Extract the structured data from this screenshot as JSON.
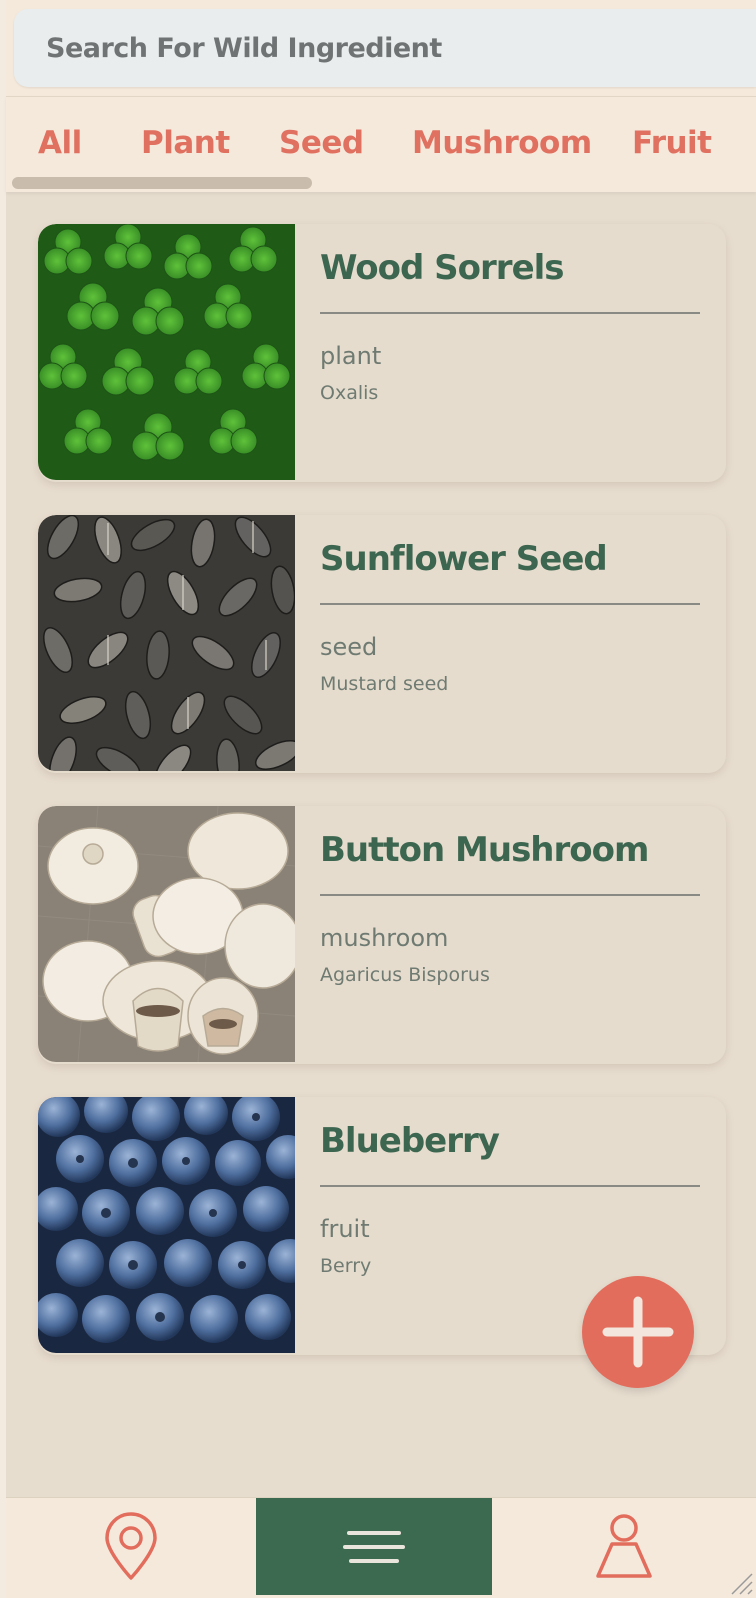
{
  "search": {
    "placeholder": "Search For Wild Ingredient"
  },
  "tabs": [
    {
      "label": "All"
    },
    {
      "label": "Plant"
    },
    {
      "label": "Seed"
    },
    {
      "label": "Mushroom"
    },
    {
      "label": "Fruit"
    }
  ],
  "ingredients": [
    {
      "name": "Wood Sorrels",
      "type": "plant",
      "scientific": "Oxalis",
      "image": "clover-leaves-photo"
    },
    {
      "name": "Sunflower Seed",
      "type": "seed",
      "scientific": "Mustard seed",
      "image": "sunflower-seeds-photo"
    },
    {
      "name": "Button Mushroom",
      "type": "mushroom",
      "scientific": "Agaricus Bisporus",
      "image": "button-mushrooms-photo"
    },
    {
      "name": "Blueberry",
      "type": "fruit",
      "scientific": "Berry",
      "image": "blueberries-photo"
    }
  ],
  "fab": {
    "icon": "plus-icon"
  },
  "bottom_nav": [
    {
      "icon": "map-pin-icon",
      "active": false
    },
    {
      "icon": "menu-icon",
      "active": true
    },
    {
      "icon": "profile-icon",
      "active": false
    }
  ],
  "colors": {
    "background": "#e7ddcf",
    "accent": "#e26d5d",
    "primary_green": "#3c6a51",
    "card": "#e6dccd",
    "search_bg": "#e9edee"
  }
}
